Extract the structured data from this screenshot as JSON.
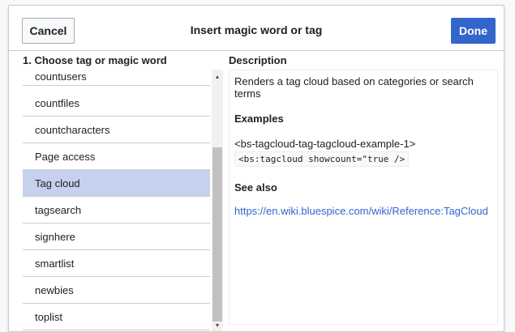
{
  "dialog": {
    "title": "Insert magic word or tag",
    "cancel_label": "Cancel",
    "done_label": "Done"
  },
  "columns": {
    "left_heading": "1. Choose tag or magic word",
    "right_heading": "Description"
  },
  "list": {
    "items": [
      "countusers",
      "countfiles",
      "countcharacters",
      "Page access",
      "Tag cloud",
      "tagsearch",
      "signhere",
      "smartlist",
      "newbies",
      "toplist"
    ],
    "selected": "Tag cloud"
  },
  "description": {
    "text": "Renders a tag cloud based on categories or search terms",
    "examples_heading": "Examples",
    "example_tag": "<bs-tagcloud-tag-tagcloud-example-1>",
    "example_code": "<bs:tagcloud showcount=\"true />",
    "see_also_heading": "See also",
    "see_also_link": "https://en.wiki.bluespice.com/wiki/Reference:TagCloud"
  },
  "colors": {
    "accent": "#3366cc",
    "selected_row": "#c5d1ed",
    "border": "#c8ccd1"
  }
}
